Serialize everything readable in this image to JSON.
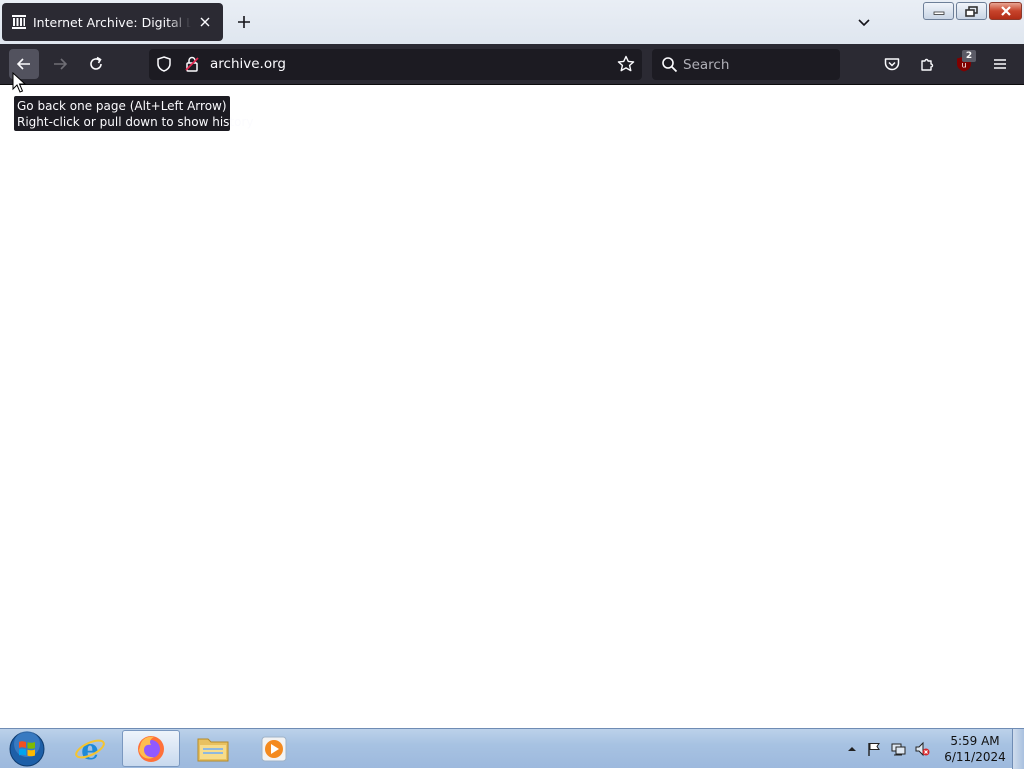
{
  "browser": {
    "tab": {
      "title": "Internet Archive: Digital Library of Free & Borrowable Books, Movies, Music & Wayback Machine",
      "favicon": "library-columns-icon"
    },
    "url": "archive.org",
    "search_placeholder": "Search",
    "extension_badge": "2",
    "tooltip_lines": [
      "Go back one page (Alt+Left Arrow)",
      "Right-click or pull down to show history"
    ]
  },
  "taskbar": {
    "apps": [
      "internet-explorer-icon",
      "firefox-icon",
      "file-explorer-icon",
      "media-player-icon"
    ],
    "active_app": "firefox-icon",
    "clock_time": "5:59 AM",
    "clock_date": "6/11/2024"
  },
  "colors": {
    "toolbar": "#2b2a33",
    "urlbar": "#1c1b22",
    "taskbar": "#a7c2e2",
    "ublock_red": "#800000"
  }
}
